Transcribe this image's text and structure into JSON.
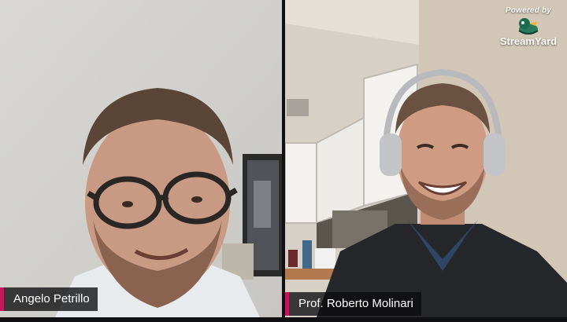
{
  "participants": [
    {
      "name": "Angelo Petrillo"
    },
    {
      "name": "Prof. Roberto Molinari"
    }
  ],
  "branding": {
    "powered_by": "Powered by",
    "name": "StreamYard",
    "icon": "streamyard-duck-logo"
  },
  "colors": {
    "name_tag_accent": "#c2185b",
    "name_tag_bg": "#0c0c0e",
    "background": "#0b0b0c"
  }
}
